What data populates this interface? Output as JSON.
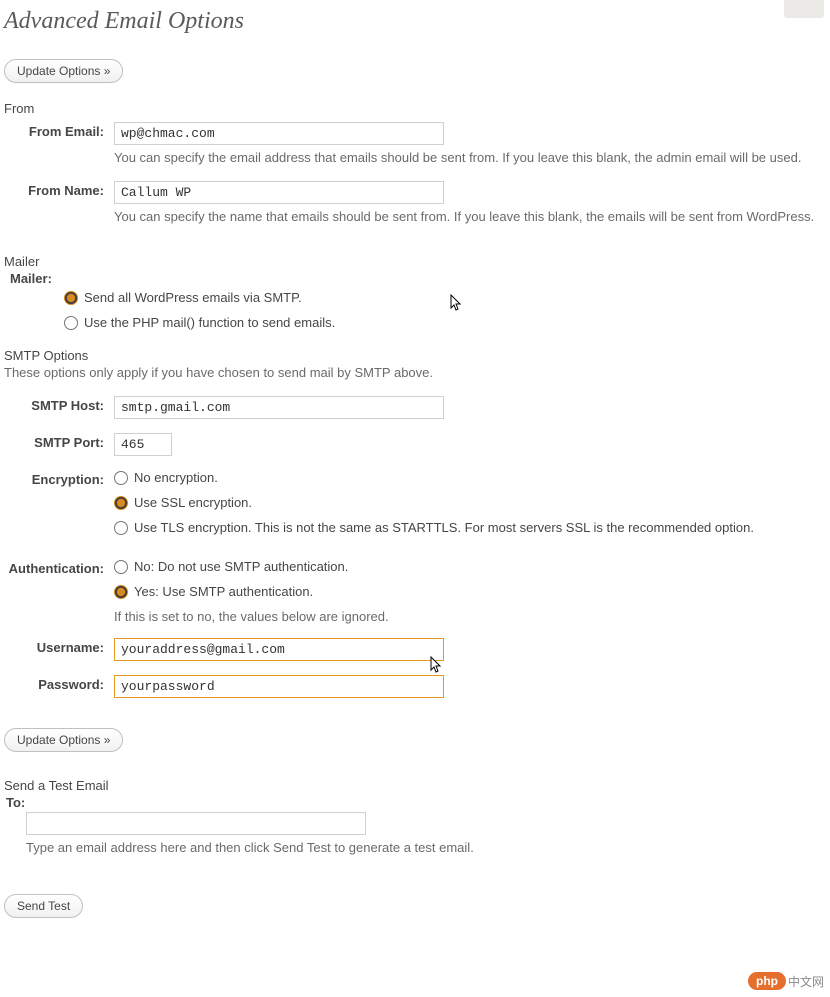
{
  "page_title": "Advanced Email Options",
  "buttons": {
    "update_options": "Update Options »",
    "send_test": "Send Test"
  },
  "from": {
    "heading": "From",
    "email_label": "From Email:",
    "email_value": "wp@chmac.com",
    "email_desc": "You can specify the email address that emails should be sent from. If you leave this blank, the admin email will be used.",
    "name_label": "From Name:",
    "name_value": "Callum WP",
    "name_desc": "You can specify the name that emails should be sent from. If you leave this blank, the emails will be sent from WordPress."
  },
  "mailer": {
    "heading": "Mailer",
    "label": "Mailer:",
    "option_smtp": "Send all WordPress emails via SMTP.",
    "option_php": "Use the PHP mail() function to send emails.",
    "selected": "smtp"
  },
  "smtp": {
    "heading": "SMTP Options",
    "note": "These options only apply if you have chosen to send mail by SMTP above.",
    "host_label": "SMTP Host:",
    "host_value": "smtp.gmail.com",
    "port_label": "SMTP Port:",
    "port_value": "465",
    "encryption_label": "Encryption:",
    "enc_none": "No encryption.",
    "enc_ssl": "Use SSL encryption.",
    "enc_tls": "Use TLS encryption. This is not the same as STARTTLS. For most servers SSL is the recommended option.",
    "enc_selected": "ssl",
    "auth_label": "Authentication:",
    "auth_no": "No: Do not use SMTP authentication.",
    "auth_yes": "Yes: Use SMTP authentication.",
    "auth_note": "If this is set to no, the values below are ignored.",
    "auth_selected": "yes",
    "user_label": "Username:",
    "user_value": "youraddress@gmail.com",
    "pass_label": "Password:",
    "pass_value": "yourpassword"
  },
  "test": {
    "heading": "Send a Test Email",
    "to_label": "To:",
    "to_value": "",
    "desc": "Type an email address here and then click Send Test to generate a test email."
  },
  "watermark": {
    "pill": "php",
    "text": "中文网"
  }
}
